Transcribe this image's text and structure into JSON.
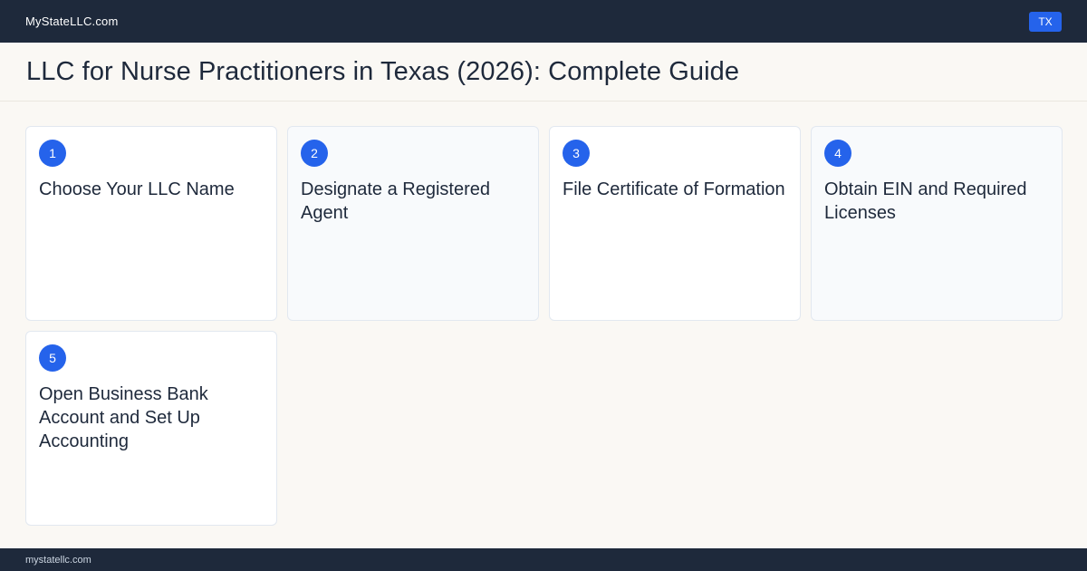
{
  "header": {
    "brand": "MyStateLLC.com",
    "state_badge": "TX"
  },
  "page": {
    "title": "LLC for Nurse Practitioners in Texas (2026): Complete Guide"
  },
  "steps": [
    {
      "number": "1",
      "title": "Choose Your LLC Name"
    },
    {
      "number": "2",
      "title": "Designate a Registered Agent"
    },
    {
      "number": "3",
      "title": "File Certificate of Formation"
    },
    {
      "number": "4",
      "title": "Obtain EIN and Required Licenses"
    },
    {
      "number": "5",
      "title": "Open Business Bank Account and Set Up Accounting"
    }
  ],
  "footer": {
    "domain": "mystatellc.com"
  },
  "colors": {
    "header_bg": "#1e293b",
    "accent": "#2563eb",
    "page_bg": "#faf8f4"
  }
}
